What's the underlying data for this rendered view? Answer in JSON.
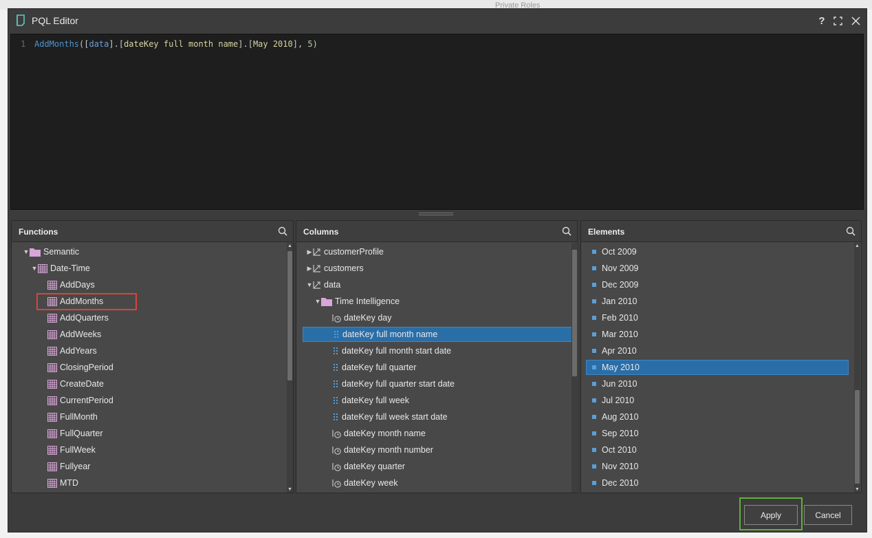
{
  "background": {
    "items": [
      "Private Roles"
    ]
  },
  "dialog": {
    "title": "PQL Editor",
    "help_label": "?",
    "code": {
      "line_number": "1",
      "tokens": [
        {
          "text": "AddMonths",
          "kind": "fn"
        },
        {
          "text": "([",
          "kind": "punc"
        },
        {
          "text": "data",
          "kind": "data"
        },
        {
          "text": "].[",
          "kind": "punc"
        },
        {
          "text": "dateKey full month name",
          "kind": "id"
        },
        {
          "text": "].[",
          "kind": "punc"
        },
        {
          "text": "May 2010",
          "kind": "id"
        },
        {
          "text": "], ",
          "kind": "punc"
        },
        {
          "text": "5",
          "kind": "num"
        },
        {
          "text": ")",
          "kind": "punc"
        }
      ]
    }
  },
  "functions": {
    "header": "Functions",
    "items": [
      {
        "label": "Semantic",
        "icon": "folder-icon",
        "level": 0,
        "expanded": true
      },
      {
        "label": "Date-Time",
        "icon": "table-icon",
        "level": 1,
        "expanded": true
      },
      {
        "label": "AddDays",
        "icon": "table-icon",
        "level": 2
      },
      {
        "label": "AddMonths",
        "icon": "table-icon",
        "level": 2,
        "highlighted": true
      },
      {
        "label": "AddQuarters",
        "icon": "table-icon",
        "level": 2
      },
      {
        "label": "AddWeeks",
        "icon": "table-icon",
        "level": 2
      },
      {
        "label": "AddYears",
        "icon": "table-icon",
        "level": 2
      },
      {
        "label": "ClosingPeriod",
        "icon": "table-icon",
        "level": 2
      },
      {
        "label": "CreateDate",
        "icon": "table-icon",
        "level": 2
      },
      {
        "label": "CurrentPeriod",
        "icon": "table-icon",
        "level": 2
      },
      {
        "label": "FullMonth",
        "icon": "table-icon",
        "level": 2
      },
      {
        "label": "FullQuarter",
        "icon": "table-icon",
        "level": 2
      },
      {
        "label": "FullWeek",
        "icon": "table-icon",
        "level": 2
      },
      {
        "label": "Fullyear",
        "icon": "table-icon",
        "level": 2
      },
      {
        "label": "MTD",
        "icon": "table-icon",
        "level": 2
      }
    ]
  },
  "columns": {
    "header": "Columns",
    "items": [
      {
        "label": "customerProfile",
        "icon": "dimension-icon",
        "level": 0,
        "arrow": "collapsed"
      },
      {
        "label": "customers",
        "icon": "dimension-icon",
        "level": 0,
        "arrow": "collapsed"
      },
      {
        "label": "data",
        "icon": "dimension-icon",
        "level": 0,
        "arrow": "expanded"
      },
      {
        "label": "Time Intelligence",
        "icon": "folder-icon",
        "level": 1,
        "arrow": "expanded"
      },
      {
        "label": "dateKey day",
        "icon": "time-level-icon",
        "level": 2
      },
      {
        "label": "dateKey full month name",
        "icon": "attribute-icon",
        "level": 2,
        "selected": true
      },
      {
        "label": "dateKey full month start date",
        "icon": "attribute-icon",
        "level": 2
      },
      {
        "label": "dateKey full quarter",
        "icon": "attribute-icon",
        "level": 2
      },
      {
        "label": "dateKey full quarter start date",
        "icon": "attribute-icon",
        "level": 2
      },
      {
        "label": "dateKey full week",
        "icon": "attribute-icon",
        "level": 2
      },
      {
        "label": "dateKey full week start date",
        "icon": "attribute-icon",
        "level": 2
      },
      {
        "label": "dateKey month name",
        "icon": "time-level-icon",
        "level": 2
      },
      {
        "label": "dateKey month number",
        "icon": "time-level-icon",
        "level": 2
      },
      {
        "label": "dateKey quarter",
        "icon": "time-level-icon",
        "level": 2
      },
      {
        "label": "dateKey week",
        "icon": "time-level-icon",
        "level": 2
      }
    ]
  },
  "elements": {
    "header": "Elements",
    "items": [
      {
        "label": "Oct 2009"
      },
      {
        "label": "Nov 2009"
      },
      {
        "label": "Dec 2009"
      },
      {
        "label": "Jan 2010"
      },
      {
        "label": "Feb 2010"
      },
      {
        "label": "Mar 2010"
      },
      {
        "label": "Apr 2010"
      },
      {
        "label": "May 2010",
        "selected": true
      },
      {
        "label": "Jun 2010"
      },
      {
        "label": "Jul 2010"
      },
      {
        "label": "Aug 2010"
      },
      {
        "label": "Sep 2010"
      },
      {
        "label": "Oct 2010"
      },
      {
        "label": "Nov 2010"
      },
      {
        "label": "Dec 2010"
      }
    ]
  },
  "footer": {
    "apply_label": "Apply",
    "cancel_label": "Cancel"
  },
  "colors": {
    "selection": "#2a6ea8",
    "highlight_red": "#d9453a",
    "highlight_green": "#62b038",
    "icon_pink": "#d9a6d9",
    "icon_blue": "#5b9fd6"
  }
}
